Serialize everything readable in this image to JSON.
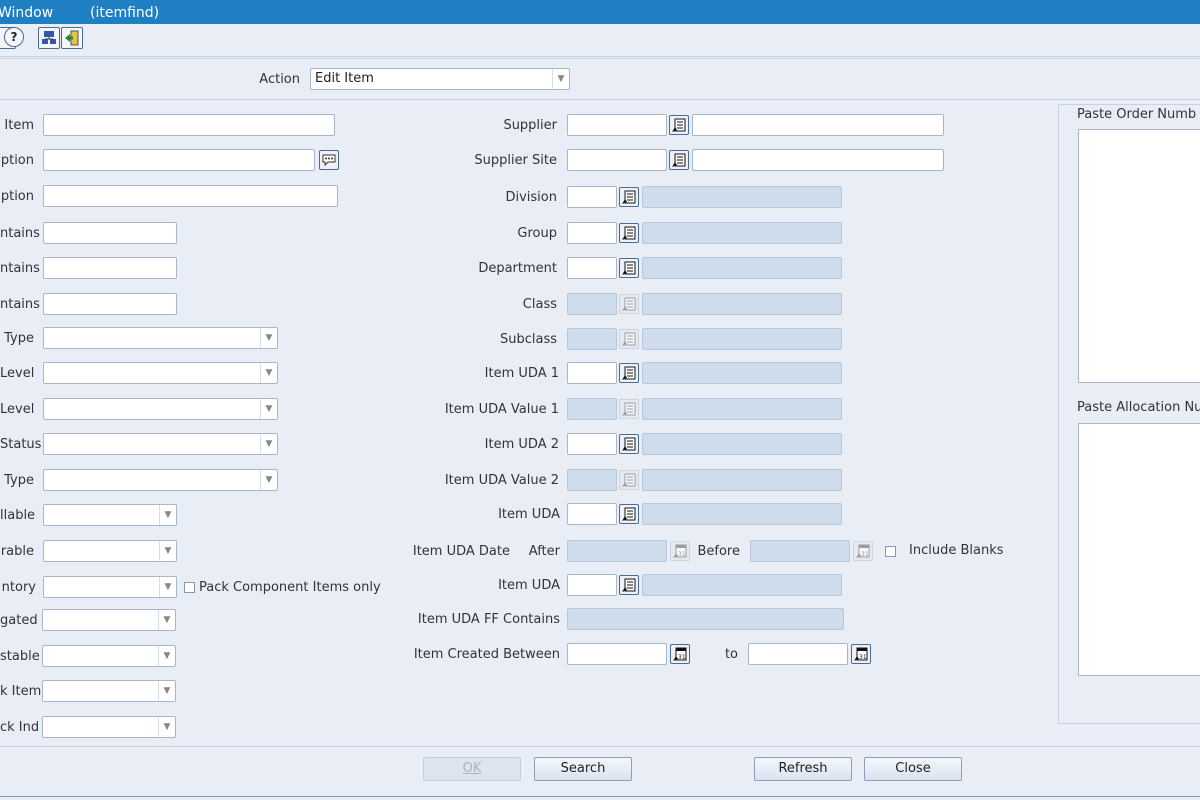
{
  "window": {
    "title_left": "Window",
    "title_right": "(itemfind)"
  },
  "toolbar": {
    "help_label": "?"
  },
  "action": {
    "label": "Action",
    "value": "Edit Item"
  },
  "left_fields": [
    "Item",
    "ption",
    "ption",
    "ntains",
    "ntains",
    "ntains",
    "Type",
    "Level",
    "Level",
    "Status",
    "Type",
    "llable",
    "rable",
    "ntory",
    "gated",
    "stable",
    "k Item",
    "ck Ind"
  ],
  "pack_component": {
    "label": "Pack Component Items only"
  },
  "mid_fields": {
    "supplier": "Supplier",
    "supplier_site": "Supplier Site",
    "division": "Division",
    "group": "Group",
    "department": "Department",
    "class": "Class",
    "subclass": "Subclass",
    "item_uda_1": "Item UDA 1",
    "item_uda_value_1": "Item UDA Value 1",
    "item_uda_2": "Item UDA 2",
    "item_uda_value_2": "Item UDA Value 2",
    "item_uda": "Item UDA",
    "item_uda_date": "Item UDA Date",
    "after": "After",
    "before": "Before",
    "include_blanks": "Include Blanks",
    "item_uda_b": "Item UDA",
    "item_uda_ff": "Item UDA FF Contains",
    "item_created_between": "Item Created Between",
    "to": "to"
  },
  "right_panel": {
    "paste_order": "Paste Order Numb",
    "paste_allocation": "Paste Allocation Nu"
  },
  "buttons": {
    "ok": "OK",
    "search": "Search",
    "refresh": "Refresh",
    "close": "Close"
  }
}
